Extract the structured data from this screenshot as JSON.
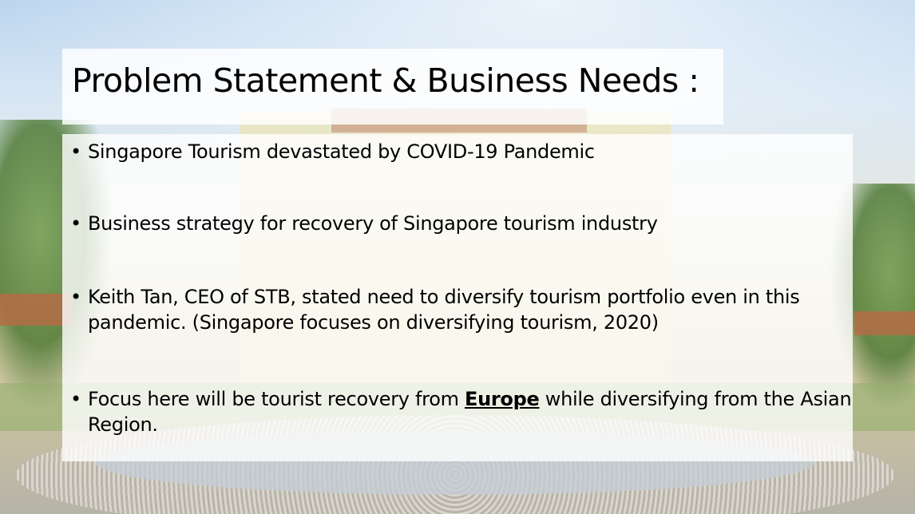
{
  "slide": {
    "title": "Problem Statement & Business Needs :",
    "bullet_symbol": "•",
    "bullets": [
      {
        "text": "Singapore Tourism devastated by COVID-19 Pandemic"
      },
      {
        "text": "Business strategy for recovery of Singapore tourism industry"
      },
      {
        "text": "Keith Tan, CEO of STB, stated need to diversify tourism portfolio even in this pandemic. (Singapore focuses on diversifying tourism, 2020)"
      },
      {
        "text_before": "Focus here will be tourist recovery from ",
        "emphasis": "Europe",
        "text_after": " while diversifying from the Asian Region."
      }
    ]
  }
}
